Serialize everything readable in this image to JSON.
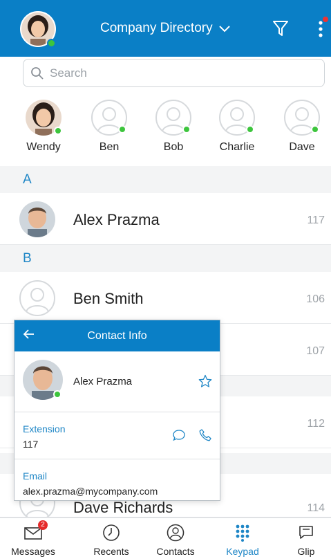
{
  "header": {
    "title": "Company Directory",
    "icons": [
      "chevron-down-icon",
      "filter-icon",
      "more-icon"
    ],
    "accent": "#0a7fc6"
  },
  "search": {
    "placeholder": "Search"
  },
  "favorites": [
    {
      "name": "Wendy",
      "photo": true
    },
    {
      "name": "Ben",
      "photo": false
    },
    {
      "name": "Bob",
      "photo": false
    },
    {
      "name": "Charlie",
      "photo": false
    },
    {
      "name": "Dave",
      "photo": false
    }
  ],
  "sections": [
    {
      "letter": "A"
    },
    {
      "letter": "B"
    }
  ],
  "contacts": [
    {
      "name": "Alex Prazma",
      "ext": "117"
    },
    {
      "name": "Ben Smith",
      "ext": "106"
    },
    {
      "name": "",
      "ext": "107"
    },
    {
      "name": "",
      "ext": "112"
    },
    {
      "name": "Dave Richards",
      "ext": "114"
    }
  ],
  "contact_info": {
    "title": "Contact Info",
    "name": "Alex Prazma",
    "extension_label": "Extension",
    "extension": "117",
    "email_label": "Email",
    "email": "alex.prazma@mycompany.com"
  },
  "nav": {
    "tabs": [
      {
        "label": "Messages",
        "icon": "messages-icon",
        "badge": "2"
      },
      {
        "label": "Recents",
        "icon": "clock-icon"
      },
      {
        "label": "Contacts",
        "icon": "contacts-icon"
      },
      {
        "label": "Keypad",
        "icon": "keypad-icon",
        "active": true
      },
      {
        "label": "Glip",
        "icon": "glip-icon"
      }
    ]
  },
  "colors": {
    "presence": "#3dc53d",
    "badge": "#e52b2b",
    "link": "#1e86c6"
  }
}
